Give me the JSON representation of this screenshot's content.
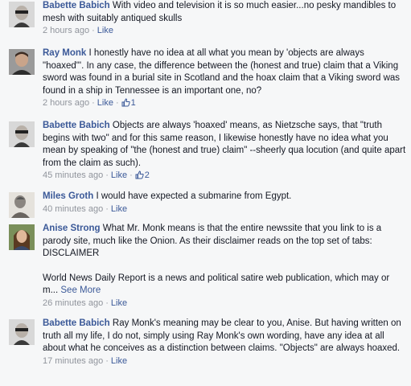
{
  "comments": [
    {
      "author": "Babette Babich",
      "text": "With video and television it is so much easier...no pesky mandibles to mesh with suitably antiqued skulls",
      "time": "2 hours ago",
      "like_label": "Like",
      "like_count": ""
    },
    {
      "author": "Ray Monk",
      "text": "I honestly have no idea at all what you mean by 'objects are always \"hoaxed\"'. In any case, the difference between the (honest and true) claim that a Viking sword was found in a burial site in Scotland and the hoax claim that a Viking sword was found in a ship in Tennessee is an important one, no?",
      "time": "2 hours ago",
      "like_label": "Like",
      "like_count": "1"
    },
    {
      "author": "Babette Babich",
      "text": "Objects are always 'hoaxed' means, as Nietzsche says, that \"truth begins with two\" and for this same reason, I likewise honestly have no idea what you mean by speaking of \"the (honest and true) claim\" --sheerly qua locution (and quite apart from the claim as such).",
      "time": "45 minutes ago",
      "like_label": "Like",
      "like_count": "2"
    },
    {
      "author": "Miles Groth",
      "text": "I would have expected a submarine from Egypt.",
      "time": "40 minutes ago",
      "like_label": "Like",
      "like_count": ""
    },
    {
      "author": "Anise Strong",
      "text": "What Mr. Monk means is that the entire newssite that you link to is a parody site, much like the Onion. As their disclaimer reads on the top set of tabs: DISCLAIMER",
      "text_2": "World News Daily Report is a news and political satire web publication, which may or m...",
      "see_more": "See More",
      "time": "26 minutes ago",
      "like_label": "Like",
      "like_count": ""
    },
    {
      "author": "Babette Babich",
      "text": "Ray Monk's meaning may be clear to you, Anise. But having written on truth all my life, I do not, simply using Ray Monk's own wording, have any idea at all about what he conceives as a distinction between claims. \"Objects\" are always hoaxed.",
      "time": "17 minutes ago",
      "like_label": "Like",
      "like_count": ""
    }
  ],
  "colors": {
    "link": "#3b5998",
    "meta": "#90949c",
    "text": "#141823",
    "background": "#f6f7f8"
  },
  "icons": {
    "like_count_icon": "thumbs-up-icon"
  }
}
